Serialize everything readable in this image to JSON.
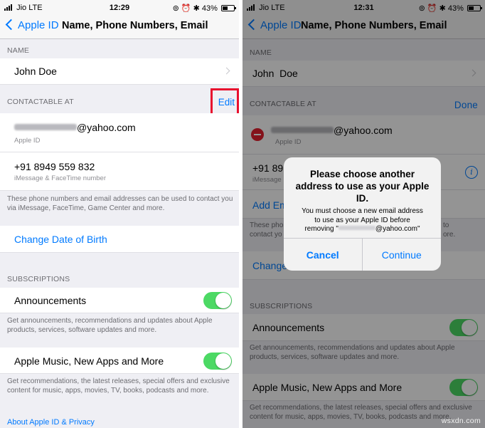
{
  "left": {
    "status": {
      "carrier": "Jio",
      "network": "LTE",
      "time": "12:29",
      "battery": "43%"
    },
    "nav": {
      "back_label": "Apple ID",
      "title": "Name, Phone Numbers, Email"
    },
    "name_section": {
      "header": "NAME",
      "name": "John Doe"
    },
    "contact_section": {
      "header": "CONTACTABLE AT",
      "edit_label": "Edit"
    },
    "email_cell": {
      "email_suffix": "@yahoo.com",
      "subtitle": "Apple ID"
    },
    "phone_cell": {
      "number": "+91 8949 559 832",
      "subtitle": "iMessage & FaceTime number"
    },
    "contact_footer": "These phone numbers and email addresses can be used to contact you via iMessage, FaceTime, Game Center and more.",
    "change_dob": "Change Date of Birth",
    "subscriptions": {
      "header": "SUBSCRIPTIONS",
      "announcements": {
        "label": "Announcements",
        "footer": "Get announcements, recommendations and updates about Apple products, services, software updates and more."
      },
      "apple_music": {
        "label": "Apple Music, New Apps and More",
        "footer": "Get recommendations, the latest releases, special offers and exclusive content for music, apps, movies, TV, books, podcasts and more."
      }
    },
    "about_link": "About Apple ID & Privacy"
  },
  "right": {
    "status": {
      "carrier": "Jio",
      "network": "LTE",
      "time": "12:31",
      "battery": "43%"
    },
    "nav": {
      "back_label": "Apple ID",
      "title": "Name, Phone Numbers, Email"
    },
    "name_section": {
      "header": "NAME",
      "name": "John  Doe"
    },
    "contact_section": {
      "header": "CONTACTABLE AT",
      "done_label": "Done"
    },
    "email_cell": {
      "email_suffix": "@yahoo.com",
      "subtitle": "Apple ID"
    },
    "phone_cell": {
      "number_partial": "+91 89",
      "subtitle_partial": "iMessage"
    },
    "add_email_partial": "Add Em",
    "footer_partial_left": "These pho\ncontact yo",
    "footer_partial_right": "to\nore.",
    "change_partial": "Change",
    "subscriptions": {
      "header": "SUBSCRIPTIONS",
      "announcements": {
        "label": "Announcements",
        "footer": "Get announcements, recommendations and updates about Apple products, services, software updates and more."
      },
      "apple_music": {
        "label": "Apple Music, New Apps and More",
        "footer": "Get recommendations, the latest releases, special offers and exclusive content for music, apps, movies, TV, books, podcasts and more."
      }
    },
    "alert": {
      "title": "Please choose another address to use as your Apple ID.",
      "message_line1": "You must choose a new email address",
      "message_line2": "to use as your Apple ID before",
      "message_prefix": "removing \"",
      "message_suffix": "@yahoo.com\"",
      "cancel_label": "Cancel",
      "continue_label": "Continue"
    }
  },
  "watermark": "wsxdn.com",
  "colors": {
    "accent": "#007aff",
    "highlight": "#e8102e",
    "toggle_on": "#4cd964",
    "delete": "#e3202f"
  }
}
